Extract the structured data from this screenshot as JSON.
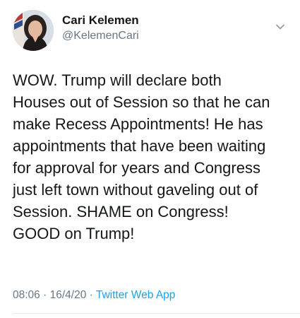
{
  "author": {
    "display_name": "Cari Kelemen",
    "handle": "@KelemenCari"
  },
  "tweet": {
    "lines": [
      "WOW. Trump will declare both",
      "Houses out of Session so that he can",
      "make Recess Appointments! He has",
      "appointments that have been waiting",
      "for approval for years and Congress",
      "just left town without gaveling out of",
      "Session. SHAME on Congress!",
      "GOOD on Trump!"
    ]
  },
  "meta": {
    "time": "08:06",
    "separator": "·",
    "date": "16/4/20",
    "source": "Twitter Web App"
  },
  "icons": {
    "avatar": "user-avatar-photo",
    "menu": "chevron-down-icon"
  },
  "colors": {
    "text": "#14171a",
    "secondary": "#657786",
    "link": "#1da1f2",
    "divider": "#e6ecf0"
  }
}
